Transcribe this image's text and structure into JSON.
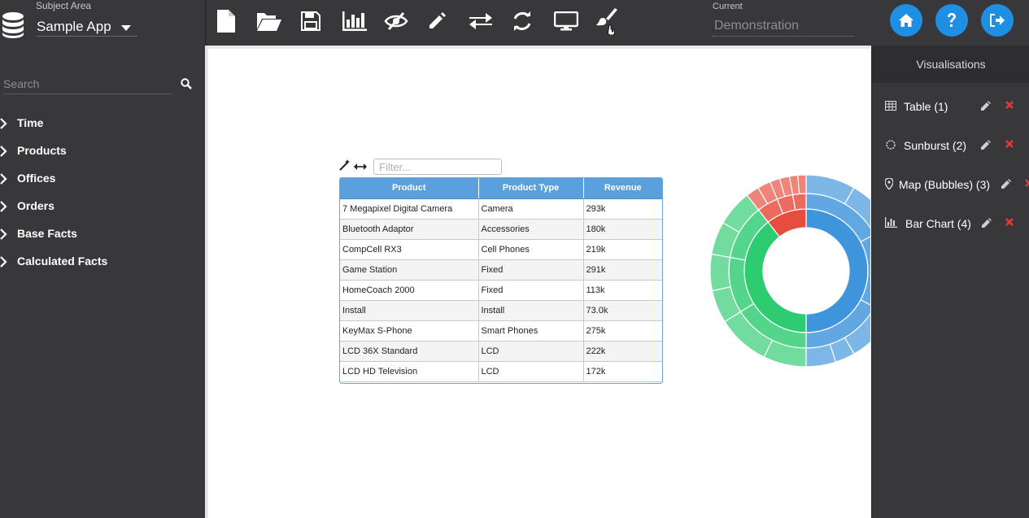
{
  "header": {
    "subject_area_caption": "Subject Area",
    "subject_area_value": "Sample App",
    "current_caption": "Current",
    "current_value": "Demonstration",
    "toolbar_icons": [
      "new-file-icon",
      "open-folder-icon",
      "save-icon",
      "bar-chart-icon",
      "hide-icon",
      "edit-icon",
      "swap-icon",
      "refresh-icon",
      "monitor-icon",
      "paintbrush-icon"
    ],
    "round_buttons": [
      "home-icon",
      "help-icon",
      "logout-icon"
    ],
    "accent_color": "#1e8fe3"
  },
  "sidebar": {
    "search_placeholder": "Search",
    "items": [
      {
        "label": "Time"
      },
      {
        "label": "Products"
      },
      {
        "label": "Offices"
      },
      {
        "label": "Orders"
      },
      {
        "label": "Base Facts"
      },
      {
        "label": "Calculated Facts"
      }
    ]
  },
  "table": {
    "filter_placeholder": "Filter...",
    "headers": [
      "Product",
      "Product Type",
      "Revenue"
    ],
    "rows": [
      [
        "7 Megapixel Digital Camera",
        "Camera",
        "293k"
      ],
      [
        "Bluetooth Adaptor",
        "Accessories",
        "180k"
      ],
      [
        "CompCell RX3",
        "Cell Phones",
        "219k"
      ],
      [
        "Game Station",
        "Fixed",
        "291k"
      ],
      [
        "HomeCoach 2000",
        "Fixed",
        "113k"
      ],
      [
        "Install",
        "Install",
        "73.0k"
      ],
      [
        "KeyMax S-Phone",
        "Smart Phones",
        "275k"
      ],
      [
        "LCD 36X Standard",
        "LCD",
        "222k"
      ],
      [
        "LCD HD Television",
        "LCD",
        "172k"
      ]
    ]
  },
  "visualisations": {
    "title": "Visualisations",
    "items": [
      {
        "label": "Table (1)",
        "icon": "table-icon"
      },
      {
        "label": "Sunburst (2)",
        "icon": "sunburst-icon"
      },
      {
        "label": "Map (Bubbles) (3)",
        "icon": "map-marker-icon"
      },
      {
        "label": "Bar Chart (4)",
        "icon": "bar-chart-icon"
      }
    ],
    "delete_color": "#e53935"
  },
  "sunburst_colors": {
    "blue": "#3e95dc",
    "green": "#2ecc71",
    "red": "#e74c3c"
  }
}
